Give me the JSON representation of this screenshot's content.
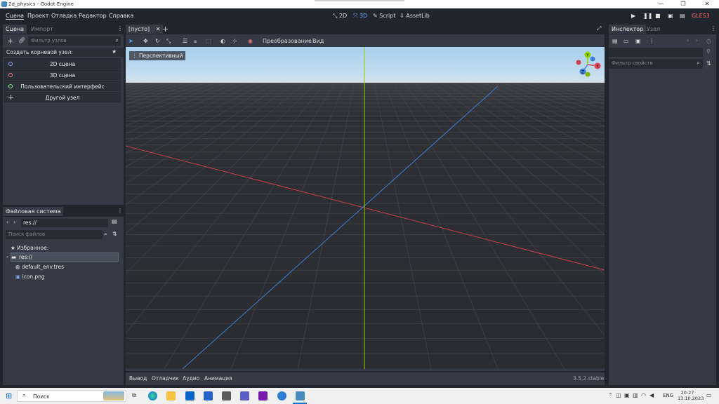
{
  "titlebar": {
    "title": "2d_physics - Godot Engine",
    "minimize": "—",
    "maximize": "❐",
    "close": "✕"
  },
  "menu": [
    "Сцена",
    "Проект",
    "Отладка",
    "Редактор",
    "Справка"
  ],
  "workspaces": {
    "w2d": "2D",
    "w3d": "3D",
    "script": "Script",
    "assetlib": "AssetLib"
  },
  "renderer": "GLES3",
  "scene_dock": {
    "tabs": [
      "Сцена",
      "Импорт"
    ],
    "filter_placeholder": "Фильтр узлов",
    "create_root_label": "Создать корневой узел:",
    "nodes": [
      {
        "label": "2D сцена",
        "color": "#8da5f3"
      },
      {
        "label": "3D сцена",
        "color": "#fc7f7f"
      },
      {
        "label": "Пользовательский интерфейс",
        "color": "#8eef97"
      },
      {
        "label": "Другой узел",
        "color": "#e0e0e0"
      }
    ]
  },
  "filesystem": {
    "tab": "Файловая система",
    "path": "res://",
    "search_placeholder": "Поиск файлов",
    "favorites": "Избранное:",
    "root": "res://",
    "files": [
      "default_env.tres",
      "icon.png"
    ]
  },
  "editor": {
    "scene_tab": "[пусто]",
    "toolbar": {
      "transform": "Преобразование",
      "view": "Вид"
    },
    "perspective_label": "Перспективный",
    "gizmo": {
      "x": "X",
      "y": "Y",
      "z": "Z"
    }
  },
  "bottom": {
    "tabs": [
      "Вывод",
      "Отладчик",
      "Аудио",
      "Анимация"
    ],
    "version": "3.5.2.stable"
  },
  "inspector": {
    "tabs": [
      "Инспектор",
      "Узел"
    ],
    "filter_placeholder": "Фильтр свойств"
  },
  "taskbar": {
    "search": "Поиск",
    "lang": "ENG",
    "time": "20:27",
    "date": "13.10.2023"
  },
  "colors": {
    "accent": "#478cbf",
    "x_axis": "#e0475a",
    "y_axis": "#8fd300",
    "z_axis": "#3e7fd6"
  }
}
